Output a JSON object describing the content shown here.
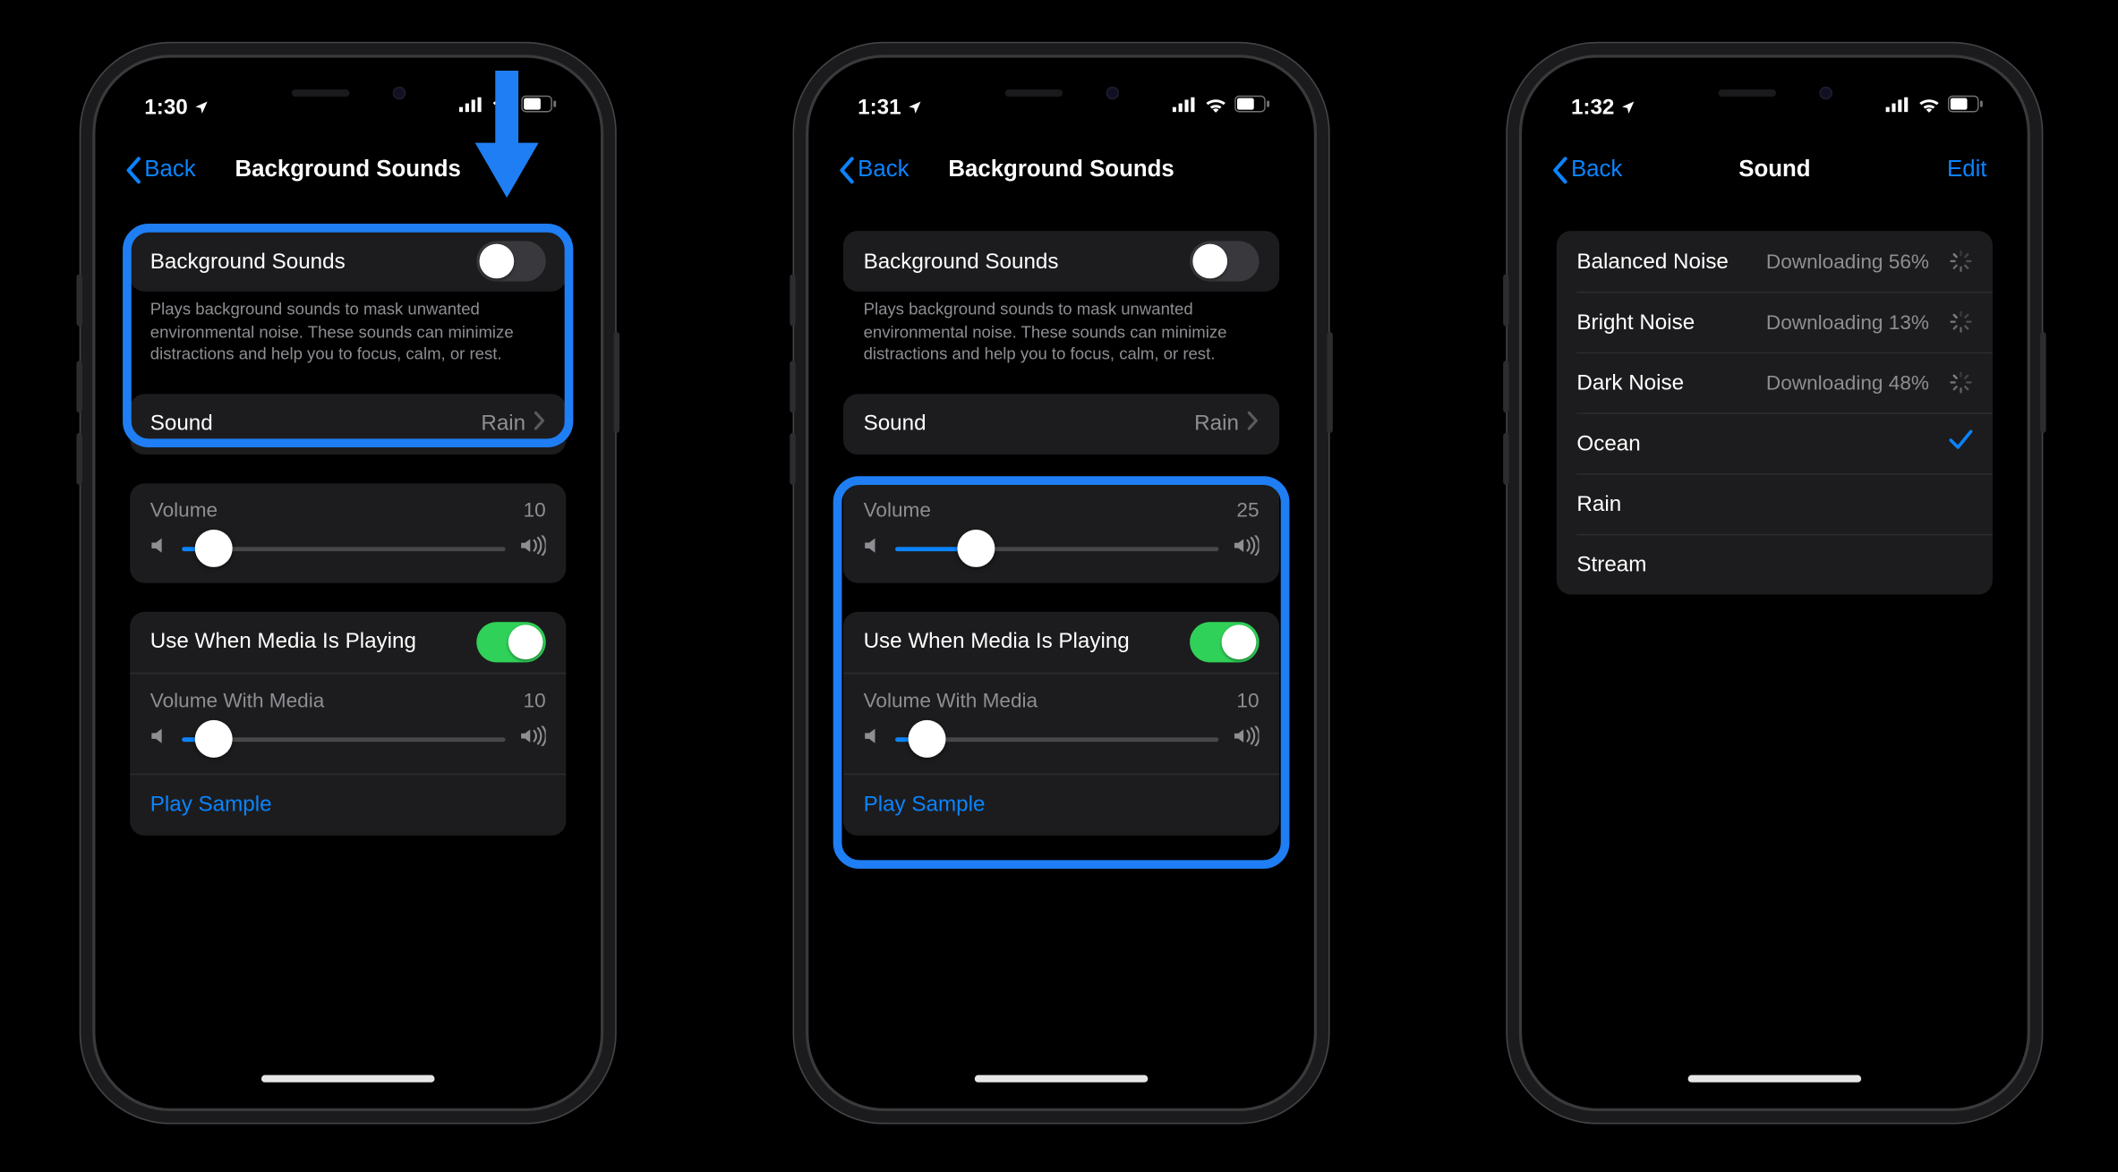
{
  "status": {
    "time_a": "1:30",
    "time_b": "1:31",
    "time_c": "1:32"
  },
  "nav": {
    "back": "Back",
    "title_bg": "Background Sounds",
    "title_sound": "Sound",
    "edit": "Edit"
  },
  "bg": {
    "toggle_label": "Background Sounds",
    "footer": "Plays background sounds to mask unwanted environmental noise. These sounds can minimize distractions and help you to focus, calm, or rest.",
    "sound_label": "Sound",
    "sound_value": "Rain",
    "volume_label": "Volume",
    "use_media_label": "Use When Media Is Playing",
    "volume_media_label": "Volume With Media",
    "play_sample": "Play Sample"
  },
  "phone_a": {
    "volume": "10",
    "volume_pct": 10,
    "volume_media": "10",
    "volume_media_pct": 10
  },
  "phone_b": {
    "volume": "25",
    "volume_pct": 25,
    "volume_media": "10",
    "volume_media_pct": 10
  },
  "sounds": [
    {
      "name": "Balanced Noise",
      "status": "Downloading 56%",
      "state": "downloading"
    },
    {
      "name": "Bright Noise",
      "status": "Downloading 13%",
      "state": "downloading"
    },
    {
      "name": "Dark Noise",
      "status": "Downloading 48%",
      "state": "downloading"
    },
    {
      "name": "Ocean",
      "status": "",
      "state": "selected"
    },
    {
      "name": "Rain",
      "status": "",
      "state": "idle"
    },
    {
      "name": "Stream",
      "status": "",
      "state": "idle"
    }
  ]
}
